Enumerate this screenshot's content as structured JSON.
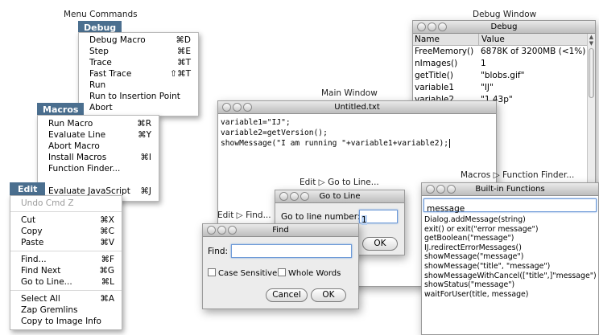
{
  "captions": {
    "menu_commands": "Menu Commands",
    "debug_window": "Debug Window",
    "main_window": "Main Window",
    "edit_goto": "Edit ▷ Go to Line...",
    "edit_find": "Edit ▷ Find...",
    "macros_finder": "Macros ▷ Function Finder..."
  },
  "debug_menu": {
    "title": "Debug",
    "items": [
      {
        "label": "Debug Macro",
        "shortcut": "⌘D"
      },
      {
        "label": "Step",
        "shortcut": "⌘E"
      },
      {
        "label": "Trace",
        "shortcut": "⌘T"
      },
      {
        "label": "Fast Trace",
        "shortcut": "⇧⌘T"
      },
      {
        "label": "Run",
        "shortcut": ""
      },
      {
        "label": "Run to Insertion Point",
        "shortcut": ""
      },
      {
        "label": "Abort",
        "shortcut": ""
      }
    ]
  },
  "macros_menu": {
    "title": "Macros",
    "items": [
      {
        "label": "Run Macro",
        "shortcut": "⌘R"
      },
      {
        "label": "Evaluate Line",
        "shortcut": "⌘Y"
      },
      {
        "label": "Abort Macro",
        "shortcut": ""
      },
      {
        "label": "Install Macros",
        "shortcut": "⌘I"
      },
      {
        "label": "Function Finder...",
        "shortcut": ""
      },
      {
        "label": "Evaluate JavaScript",
        "shortcut": "⌘J"
      }
    ]
  },
  "edit_menu": {
    "title": "Edit",
    "undo": {
      "label": "Undo",
      "shortcut": "Cmd Z"
    },
    "group1": [
      {
        "label": "Cut",
        "shortcut": "⌘X"
      },
      {
        "label": "Copy",
        "shortcut": "⌘C"
      },
      {
        "label": "Paste",
        "shortcut": "⌘V"
      }
    ],
    "group2": [
      {
        "label": "Find...",
        "shortcut": "⌘F"
      },
      {
        "label": "Find Next",
        "shortcut": "⌘G"
      },
      {
        "label": "Go to Line...",
        "shortcut": "⌘L"
      }
    ],
    "group3": [
      {
        "label": "Select All",
        "shortcut": "⌘A"
      },
      {
        "label": "Zap Gremlins",
        "shortcut": ""
      },
      {
        "label": "Copy to Image Info",
        "shortcut": ""
      }
    ]
  },
  "debug_window": {
    "title": "Debug",
    "col_name": "Name",
    "col_value": "Value",
    "rows": [
      {
        "name": "FreeMemory()",
        "value": "6878K of 3200MB (<1%)"
      },
      {
        "name": "nImages()",
        "value": "1"
      },
      {
        "name": "getTitle()",
        "value": "\"blobs.gif\""
      },
      {
        "name": "variable1",
        "value": "\"IJ\""
      },
      {
        "name": "variable2",
        "value": "\"1.43p\""
      }
    ]
  },
  "main_window": {
    "title": "Untitled.txt",
    "line1": "variable1=\"IJ\";",
    "line2": "variable2=getVersion();",
    "line3": "",
    "line4": "showMessage(\"I am running \"+variable1+variable2);"
  },
  "goto_dialog": {
    "title": "Go to Line",
    "label": "Go to line number:",
    "value": "1",
    "ok": "OK"
  },
  "find_dialog": {
    "title": "Find",
    "find_label": "Find:",
    "find_value": "",
    "case_sensitive": "Case Sensitive",
    "whole_words": "Whole Words",
    "cancel": "Cancel",
    "ok": "OK"
  },
  "builtin_window": {
    "title": "Built-in Functions",
    "search_value": "message",
    "items": [
      "Dialog.addMessage(string)",
      "exit() or exit(\"error message\")",
      "getBoolean(\"message\")",
      "IJ.redirectErrorMessages()",
      "showMessage(\"message\")",
      "showMessage(\"title\", \"message\")",
      "showMessageWithCancel([\"title\",]\"message\")",
      "showStatus(\"message\")",
      "waitForUser(title, message)"
    ]
  }
}
